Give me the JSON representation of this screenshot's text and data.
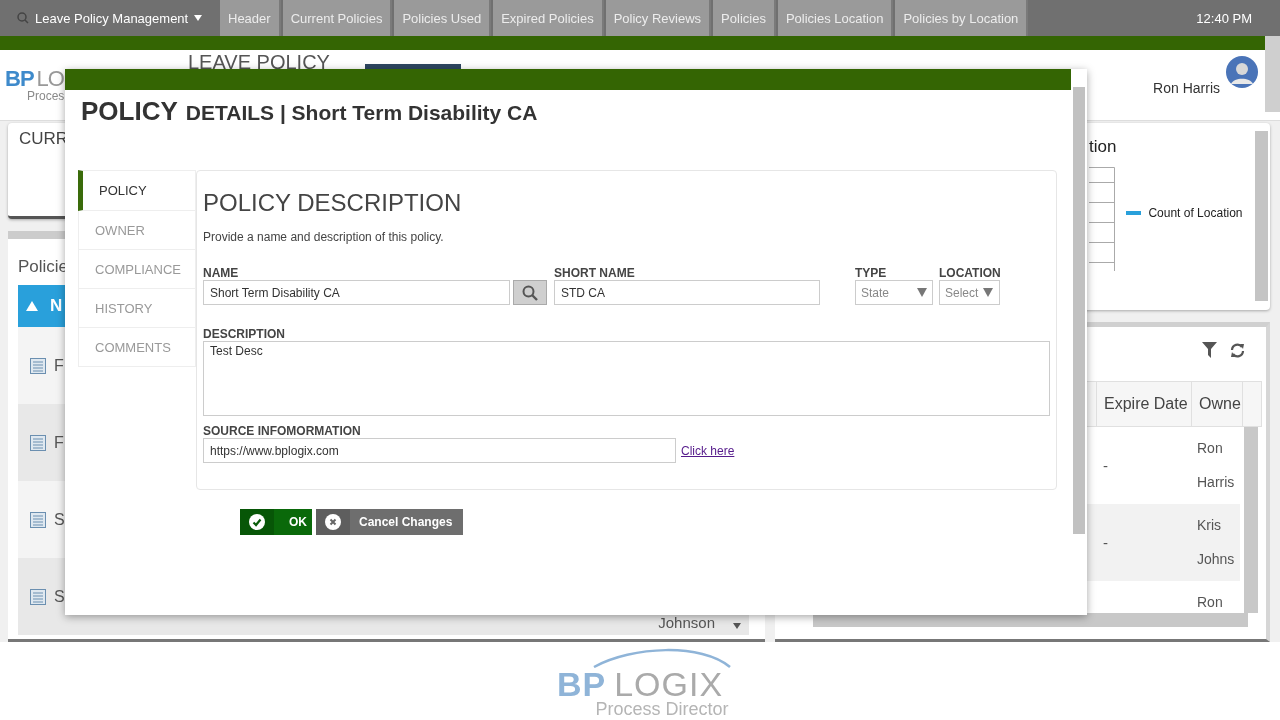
{
  "top_nav": {
    "app_menu": "Leave Policy Management",
    "tabs": [
      {
        "label": "Header",
        "selected": false
      },
      {
        "label": "Current Policies",
        "selected": false
      },
      {
        "label": "Policies Used",
        "selected": false
      },
      {
        "label": "Expired Policies",
        "selected": false
      },
      {
        "label": "Policy Reviews",
        "selected": false
      },
      {
        "label": "Policies",
        "selected": false
      },
      {
        "label": "Policies Location",
        "selected": false
      },
      {
        "label": "Policies by Location",
        "selected": false
      }
    ],
    "time": "12:40 PM"
  },
  "header": {
    "logo": {
      "brand_1": "BP",
      "brand_2": "LO",
      "product": "Proces"
    },
    "title": "LEAVE POLICY",
    "user": "Ron Harris"
  },
  "current_card": {
    "title": "CURR"
  },
  "policies_panel": {
    "title": "Policie",
    "column_1": "N",
    "rows": [
      {
        "name": "F"
      },
      {
        "name": "F"
      },
      {
        "name": "S"
      },
      {
        "name": "S"
      }
    ],
    "last_owner": "Johnson"
  },
  "chart_card": {
    "title": "tion",
    "legend": "Count of Location"
  },
  "owner_table": {
    "columns": [
      "Expire Date",
      "Owne"
    ],
    "rows": [
      {
        "expire_date": "-",
        "owner": "Ron Harris"
      },
      {
        "expire_date": "-",
        "owner": "Kris Johns"
      },
      {
        "expire_date": "",
        "owner": "Ron"
      }
    ]
  },
  "dialog": {
    "title_lead": "POLICY",
    "title_rest": "DETAILS | Short Term Disability CA",
    "tabs": [
      {
        "label": "POLICY",
        "selected": true
      },
      {
        "label": "OWNER",
        "selected": false
      },
      {
        "label": "COMPLIANCE",
        "selected": false
      },
      {
        "label": "HISTORY",
        "selected": false
      },
      {
        "label": "COMMENTS",
        "selected": false
      }
    ],
    "section_title": "POLICY DESCRIPTION",
    "intro": "Provide a name and description of this policy.",
    "name": {
      "label": "NAME",
      "value": "Short Term Disability CA"
    },
    "short_name": {
      "label": "SHORT NAME",
      "value": "STD CA"
    },
    "type": {
      "label": "TYPE",
      "value": "State"
    },
    "location": {
      "label": "LOCATION",
      "value": "Select"
    },
    "description": {
      "label": "DESCRIPTION",
      "value": "Test Desc"
    },
    "source": {
      "label": "SOURCE INFOMORMATION",
      "value": "https://www.bplogix.com",
      "link": "Click here"
    },
    "buttons": [
      {
        "kind": "ok",
        "label": "OK"
      },
      {
        "kind": "cancel",
        "label": "Cancel Changes"
      }
    ]
  },
  "footer_logo": {
    "brand_1": "BP",
    "brand_2": "LOGIX",
    "product": "Process Director"
  }
}
